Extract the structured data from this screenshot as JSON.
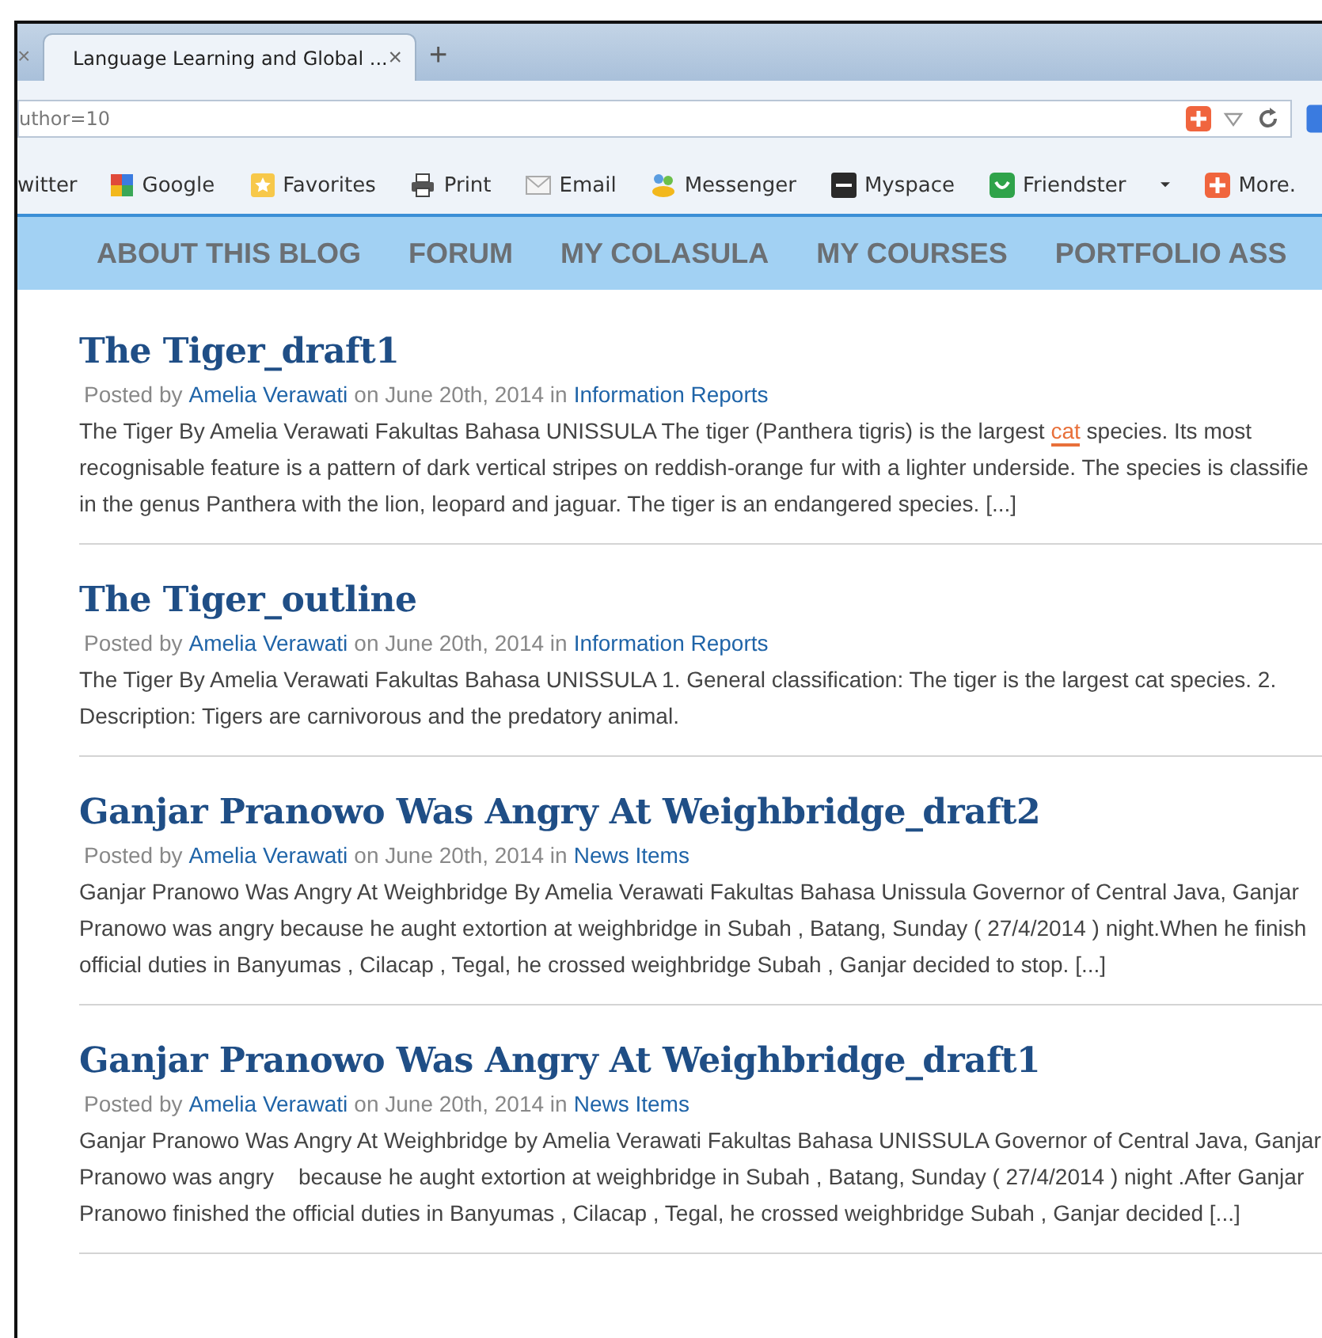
{
  "browser": {
    "prev_tab_close": "×",
    "tab": {
      "title": "Language Learning and Global ...",
      "close": "×"
    },
    "new_tab": "+",
    "address": "uthor=10",
    "bookmarks": [
      {
        "kind": "twitter",
        "label": "witter"
      },
      {
        "kind": "google",
        "label": "Google"
      },
      {
        "kind": "star",
        "label": "Favorites"
      },
      {
        "kind": "print",
        "label": "Print"
      },
      {
        "kind": "mail",
        "label": "Email"
      },
      {
        "kind": "people",
        "label": "Messenger"
      },
      {
        "kind": "my",
        "label": "Myspace"
      },
      {
        "kind": "smile",
        "label": "Friendster"
      },
      {
        "kind": "dropdown"
      },
      {
        "kind": "plus",
        "label": "More."
      }
    ]
  },
  "nav": [
    "ABOUT THIS BLOG",
    "FORUM",
    "MY COLASULA",
    "MY COURSES",
    "PORTFOLIO ASS"
  ],
  "posts": [
    {
      "title": "The Tiger_draft1",
      "posted_by": "Posted by",
      "author": "Amelia Verawati",
      "on": "on June 20th, 2014 in",
      "category": "Information Reports",
      "lines": [
        [
          {
            "kind": "text",
            "text": "The Tiger By Amelia Verawati Fakultas Bahasa UNISSULA The tiger (Panthera tigris) is the largest "
          },
          {
            "kind": "link",
            "text": "cat"
          },
          {
            "kind": "text",
            "text": " species. Its most"
          }
        ],
        [
          {
            "kind": "text",
            "text": "recognisable feature is a pattern of dark vertical stripes on reddish-orange fur with a lighter underside. The species is classifie"
          }
        ],
        [
          {
            "kind": "text",
            "text": "in the genus Panthera with the lion, leopard and jaguar. The tiger is an endangered species. [...]"
          }
        ]
      ]
    },
    {
      "title": "The Tiger_outline",
      "posted_by": "Posted by",
      "author": "Amelia Verawati",
      "on": "on June 20th, 2014 in",
      "category": "Information Reports",
      "lines": [
        [
          {
            "kind": "text",
            "text": "The Tiger By Amelia Verawati Fakultas Bahasa UNISSULA 1. General classification: The tiger is the largest cat species. 2."
          }
        ],
        [
          {
            "kind": "text",
            "text": "Description: Tigers are carnivorous and the predatory animal."
          }
        ]
      ]
    },
    {
      "title": "Ganjar Pranowo Was Angry At Weighbridge_draft2",
      "posted_by": "Posted by",
      "author": "Amelia Verawati",
      "on": "on June 20th, 2014 in",
      "category": "News Items",
      "lines": [
        [
          {
            "kind": "text",
            "text": "Ganjar Pranowo Was Angry At Weighbridge By Amelia Verawati Fakultas Bahasa Unissula Governor of Central Java, Ganjar"
          }
        ],
        [
          {
            "kind": "text",
            "text": "Pranowo was angry because he aught extortion at weighbridge in Subah , Batang, Sunday ( 27/4/2014 ) night.When he finish"
          }
        ],
        [
          {
            "kind": "text",
            "text": "official duties in Banyumas , Cilacap , Tegal, he crossed weighbridge Subah , Ganjar decided to stop. [...]"
          }
        ]
      ]
    },
    {
      "title": "Ganjar Pranowo Was Angry At Weighbridge_draft1",
      "posted_by": "Posted by",
      "author": "Amelia Verawati",
      "on": "on June 20th, 2014 in",
      "category": "News Items",
      "lines": [
        [
          {
            "kind": "text",
            "text": "Ganjar Pranowo Was Angry At Weighbridge by Amelia Verawati Fakultas Bahasa UNISSULA Governor of Central Java, Ganjar"
          }
        ],
        [
          {
            "kind": "text",
            "text": "Pranowo was angry    because he aught extortion at weighbridge in Subah , Batang, Sunday ( 27/4/2014 ) night .After Ganjar"
          }
        ],
        [
          {
            "kind": "text",
            "text": "Pranowo finished the official duties in Banyumas , Cilacap , Tegal, he crossed weighbridge Subah , Ganjar decided [...]"
          }
        ]
      ]
    }
  ]
}
